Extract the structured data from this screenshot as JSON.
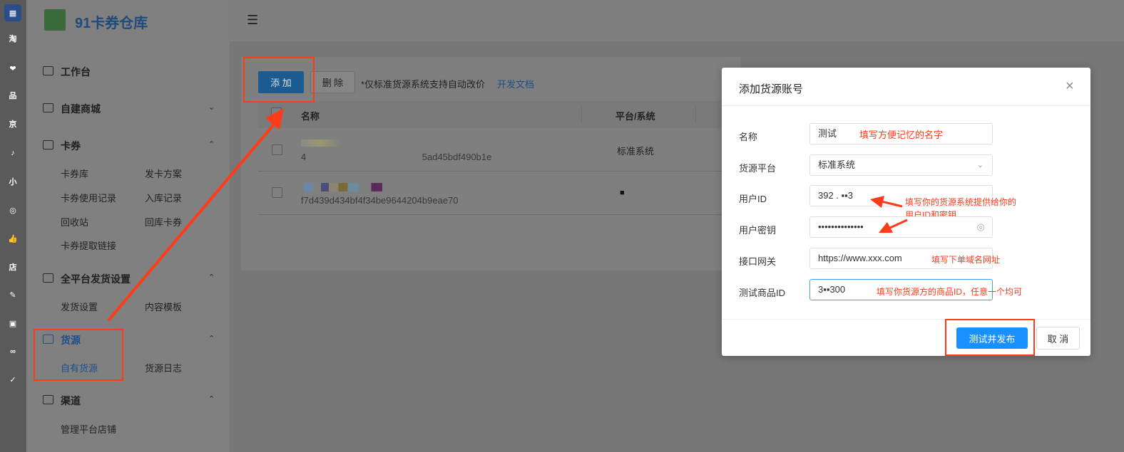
{
  "brand": {
    "title": "91卡券仓库"
  },
  "rail": {
    "items": [
      {
        "icon": "qr-logo-icon",
        "text": "",
        "color": "#2a4e8a"
      },
      {
        "icon": "taobao-icon",
        "text": "淘",
        "color": "#b86a2d"
      },
      {
        "icon": "pinduoduo-icon",
        "text": "❤",
        "color": "#a3272b"
      },
      {
        "icon": "pinbei-icon",
        "text": "品",
        "color": "#b59b2a"
      },
      {
        "icon": "jd-icon",
        "text": "京",
        "color": "#a5242a"
      },
      {
        "icon": "tiktok-icon",
        "text": "♪",
        "color": "#111111"
      },
      {
        "icon": "xiaohongshu-icon",
        "text": "小",
        "color": "#a5242a"
      },
      {
        "icon": "group-icon",
        "text": "◎",
        "color": "#a5532a"
      },
      {
        "icon": "like-icon",
        "text": "👍",
        "color": "#a5242a"
      },
      {
        "icon": "shop-icon",
        "text": "店",
        "color": "#a5242a"
      },
      {
        "icon": "edit-icon",
        "text": "✎",
        "color": "#a55a2a"
      },
      {
        "icon": "clipboard-icon",
        "text": "▣",
        "color": "#a5532a"
      },
      {
        "icon": "link-icon",
        "text": "∞",
        "color": "#1d4f8a"
      },
      {
        "icon": "checkout-icon",
        "text": "✓",
        "color": "#a55a2a"
      }
    ]
  },
  "sidebar": {
    "workbench": "工作台",
    "mall": "自建商城",
    "coupon": {
      "title": "卡券",
      "items": [
        "卡券库",
        "发卡方案",
        "卡券使用记录",
        "入库记录",
        "回收站",
        "回库卡券",
        "卡券提取链接"
      ]
    },
    "shipping": {
      "title": "全平台发货设置",
      "items": [
        "发货设置",
        "内容模板"
      ]
    },
    "source": {
      "title": "货源",
      "items": [
        "自有货源",
        "货源日志"
      ]
    },
    "channel": {
      "title": "渠道",
      "items": [
        "管理平台店铺"
      ]
    }
  },
  "toolbar": {
    "add": "添 加",
    "delete": "删 除",
    "tip": "*仅标准货源系统支持自动改价",
    "doc_link": "开发文档"
  },
  "table": {
    "headers": [
      "名称",
      "平台/系统"
    ],
    "rows": [
      {
        "id": "4                                             5ad45bdf490b1e",
        "platform": "标准系统"
      },
      {
        "id": "f7d439d434bf4f34be9644204b9eae70",
        "platform": "■"
      }
    ]
  },
  "modal": {
    "title": "添加货源账号",
    "fields": [
      {
        "label": "名称",
        "value": "测试",
        "note": "填写方便记忆的名字"
      },
      {
        "label": "货源平台",
        "value": "标准系统",
        "note": ""
      },
      {
        "label": "用户ID",
        "value": "392 . ▪▪3",
        "note": "填写你的货源系统提供给你的"
      },
      {
        "label": "用户密钥",
        "value": "••••••••••••••",
        "note": ""
      },
      {
        "label": "接口网关",
        "value": "https://www.xxx.com",
        "note": "填写下单域名网址"
      },
      {
        "label": "测试商品ID",
        "value": "3▪▪300",
        "note": "填写你货源方的商品ID，任意一个均可"
      }
    ],
    "note_userid_line2": "用户ID和密钥",
    "submit": "测试并发布",
    "cancel": "取 消"
  },
  "colors": {
    "highlight": "#ff3b1a",
    "primary": "#1890ff",
    "link": "#1d5fa8"
  }
}
